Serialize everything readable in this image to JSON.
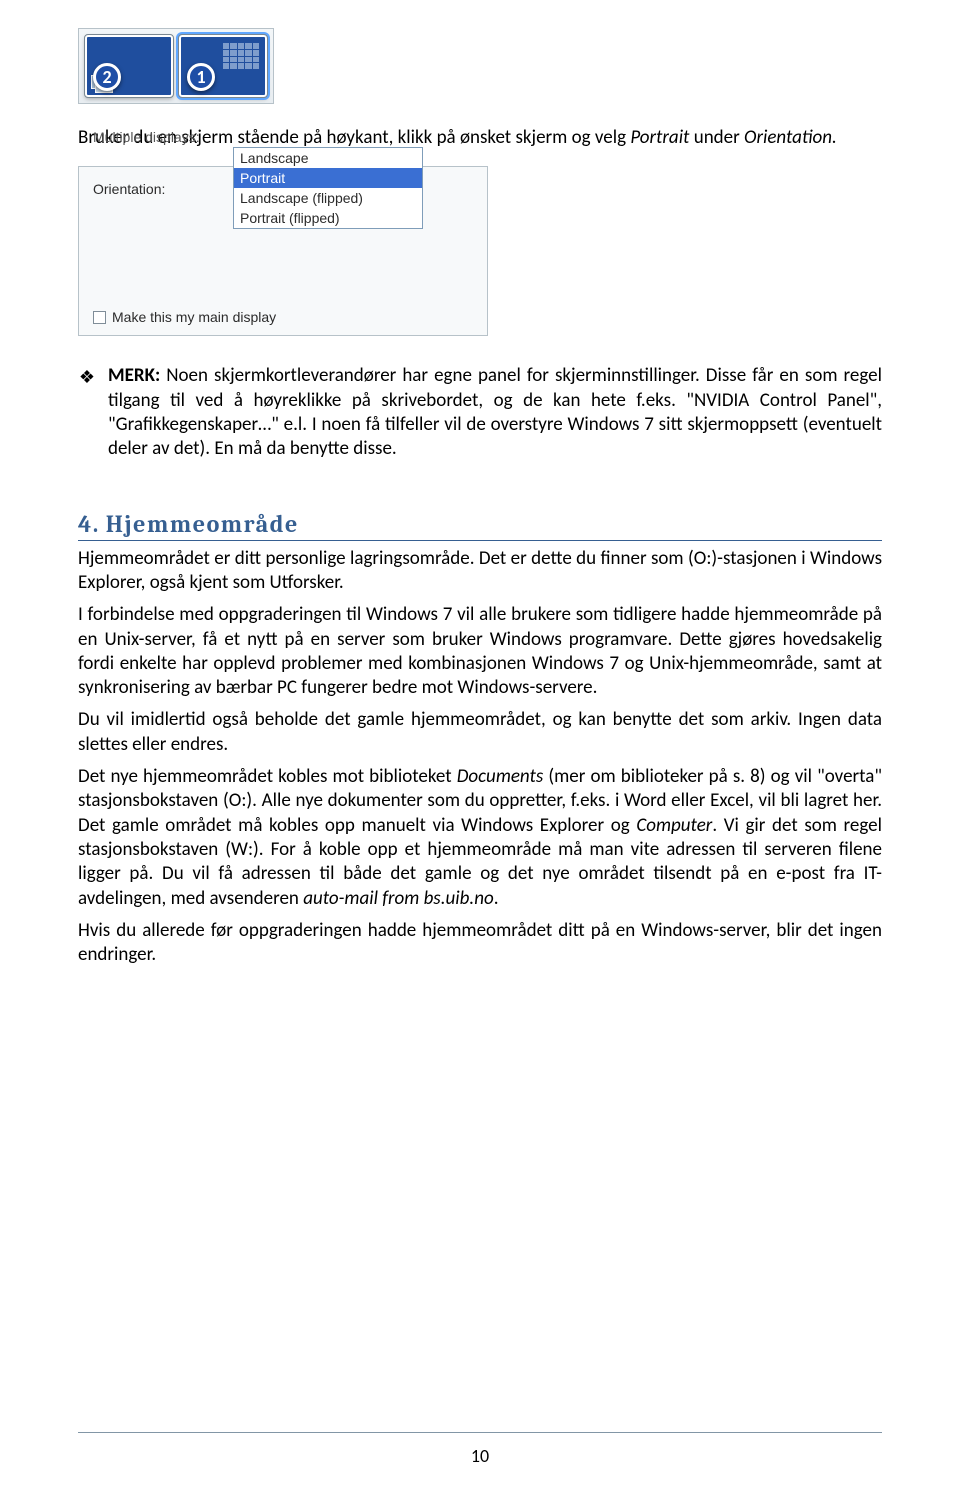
{
  "figures": {
    "monitors": {
      "left_number": "2",
      "right_number": "1"
    },
    "orientation_panel": {
      "label_orientation": "Orientation:",
      "combo_value": "Landscape",
      "options": [
        "Landscape",
        "Portrait",
        "Landscape (flipped)",
        "Portrait (flipped)"
      ],
      "highlighted_option_index": 1,
      "label_multiple": "Multiple displays:",
      "checkbox_label": "Make this my main display"
    }
  },
  "para1_pre": "Bruker du en skjerm stående på høykant, klikk på ønsket skjerm og velg ",
  "para1_em": "Portrait",
  "para1_post": " under ",
  "para1_em2": "Orientation.",
  "bullet": {
    "bold": "MERK:",
    "text": " Noen skjermkortleverandører har egne panel for skjerminnstillinger. Disse får en som regel tilgang til ved å høyreklikke på skrivebordet, og de kan hete f.eks. \"NVIDIA Control Panel\", \"Grafikkegenskaper…\" e.l. I noen få tilfeller vil de overstyre Windows 7 sitt skjermoppsett (eventuelt deler av det). En må da benytte disse."
  },
  "heading": {
    "num": "4.",
    "title": "Hjemmeområde"
  },
  "p2a": "Hjemmeområdet er ditt personlige lagringsområde. Det er dette du finner som (O:)-stasjonen i Windows Explorer, også kjent som Utforsker.",
  "p2b": "I forbindelse med oppgraderingen til Windows 7 vil alle brukere som tidligere hadde hjemmeområde på en Unix-server, få et nytt på en server som bruker Windows programvare. Dette gjøres hovedsakelig fordi enkelte har opplevd problemer med kombinasjonen Windows 7 og Unix-hjemmeområde, samt at synkronisering av bærbar PC fungerer bedre mot Windows-servere.",
  "p2c": "Du vil imidlertid også beholde det gamle hjemmeområdet, og kan benytte det som arkiv. Ingen data slettes eller endres.",
  "p2d_pre": "Det nye hjemmeområdet kobles mot biblioteket ",
  "p2d_em1": "Documents",
  "p2d_mid1": " (mer om biblioteker på s. 8) og vil \"overta\" stasjonsbokstaven (O:). Alle nye dokumenter som du oppretter, f.eks. i Word eller Excel, vil bli lagret her. Det gamle området må kobles opp manuelt via Windows Explorer og ",
  "p2d_em2": "Computer",
  "p2d_mid2": ". Vi gir det som regel stasjonsbokstaven (W:).  For å koble opp et hjemmeområde må man vite adressen til serveren filene ligger på. Du vil få adressen til både det gamle og det nye området tilsendt på en e-post fra IT-avdelingen, med avsenderen ",
  "p2d_em3": "auto-mail from bs.uib.no",
  "p2d_end": ".",
  "p2e": "Hvis du allerede før oppgraderingen hadde hjemmeområdet ditt på en Windows-server, blir det ingen endringer.",
  "page_number": "10"
}
